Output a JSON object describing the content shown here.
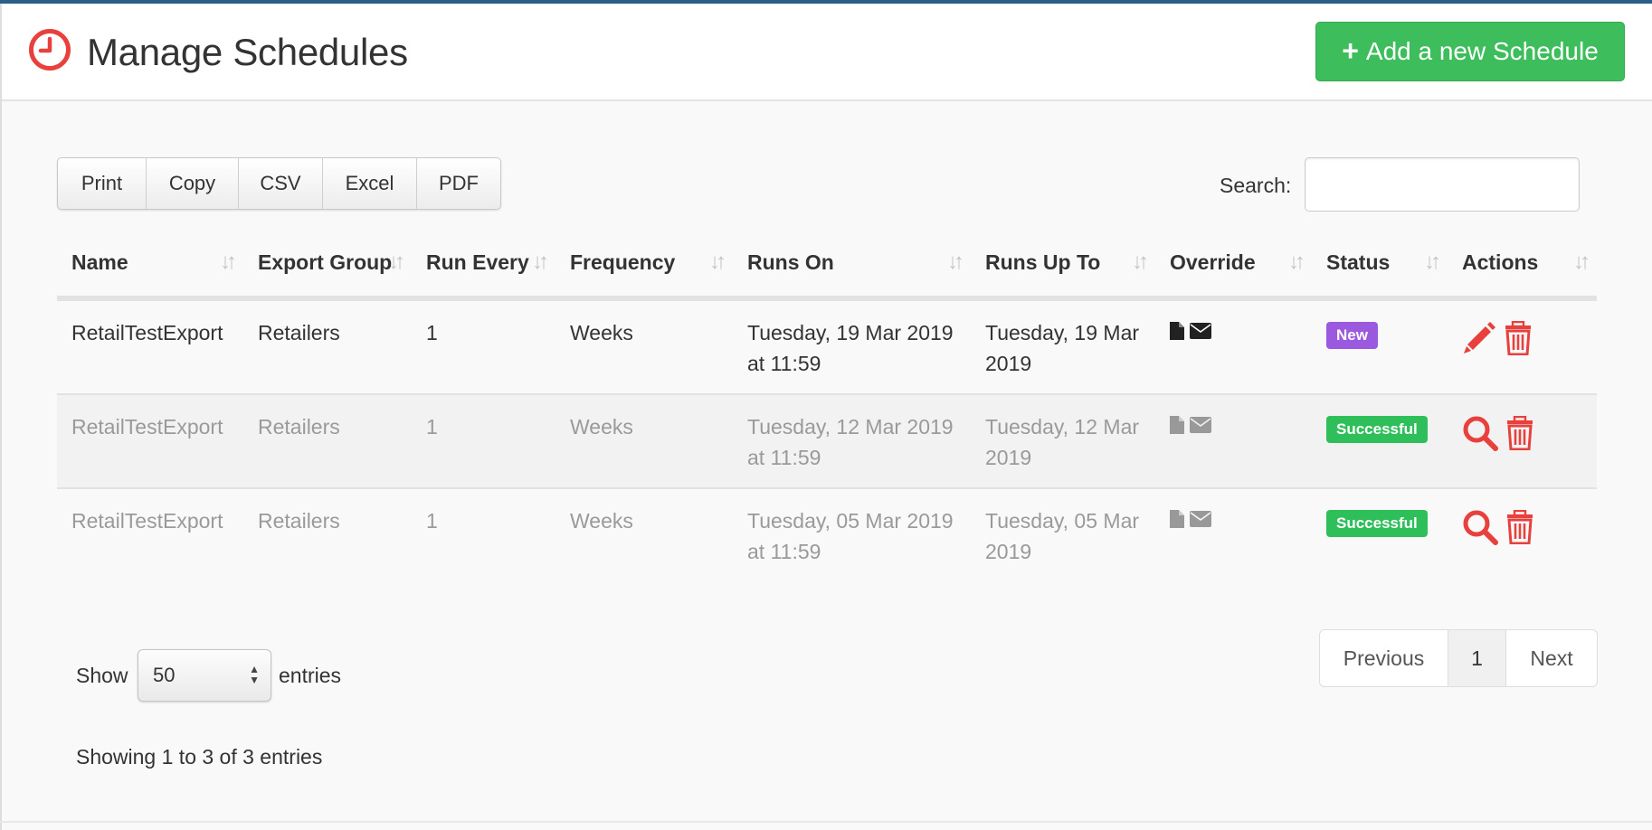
{
  "header": {
    "title": "Manage Schedules",
    "add_button_label": "Add a new Schedule"
  },
  "toolbar": {
    "export_buttons": [
      "Print",
      "Copy",
      "CSV",
      "Excel",
      "PDF"
    ],
    "search_label": "Search:",
    "search_value": ""
  },
  "table": {
    "columns": [
      "Name",
      "Export Group",
      "Run Every",
      "Frequency",
      "Runs On",
      "Runs Up To",
      "Override",
      "Status",
      "Actions"
    ],
    "rows": [
      {
        "name": "RetailTestExport",
        "export_group": "Retailers",
        "run_every": "1",
        "frequency": "Weeks",
        "runs_on": "Tuesday, 19 Mar 2019 at 11:59",
        "runs_up_to": "Tuesday, 19 Mar 2019",
        "status": "New",
        "status_color": "#9b59e0",
        "action": "edit"
      },
      {
        "name": "RetailTestExport",
        "export_group": "Retailers",
        "run_every": "1",
        "frequency": "Weeks",
        "runs_on": "Tuesday, 12 Mar 2019 at 11:59",
        "runs_up_to": "Tuesday, 12 Mar 2019",
        "status": "Successful",
        "status_color": "#2fbf5a",
        "action": "view"
      },
      {
        "name": "RetailTestExport",
        "export_group": "Retailers",
        "run_every": "1",
        "frequency": "Weeks",
        "runs_on": "Tuesday, 05 Mar 2019 at 11:59",
        "runs_up_to": "Tuesday, 05 Mar 2019",
        "status": "Successful",
        "status_color": "#2fbf5a",
        "action": "view"
      }
    ]
  },
  "footer": {
    "show_label": "Show",
    "page_size": "50",
    "entries_label": "entries",
    "info": "Showing 1 to 3 of 3 entries",
    "pager": {
      "previous": "Previous",
      "current": "1",
      "next": "Next"
    }
  },
  "colors": {
    "brand_red": "#e8403d",
    "add_green": "#3ebd5c",
    "top_bar": "#2a5f87"
  },
  "icons": {
    "title": "clock-icon",
    "add": "plus-icon",
    "override": [
      "file-icon",
      "envelope-icon"
    ],
    "edit": "pencil-icon",
    "view": "search-icon",
    "delete": "trash-icon",
    "sort": "sort-icon"
  }
}
